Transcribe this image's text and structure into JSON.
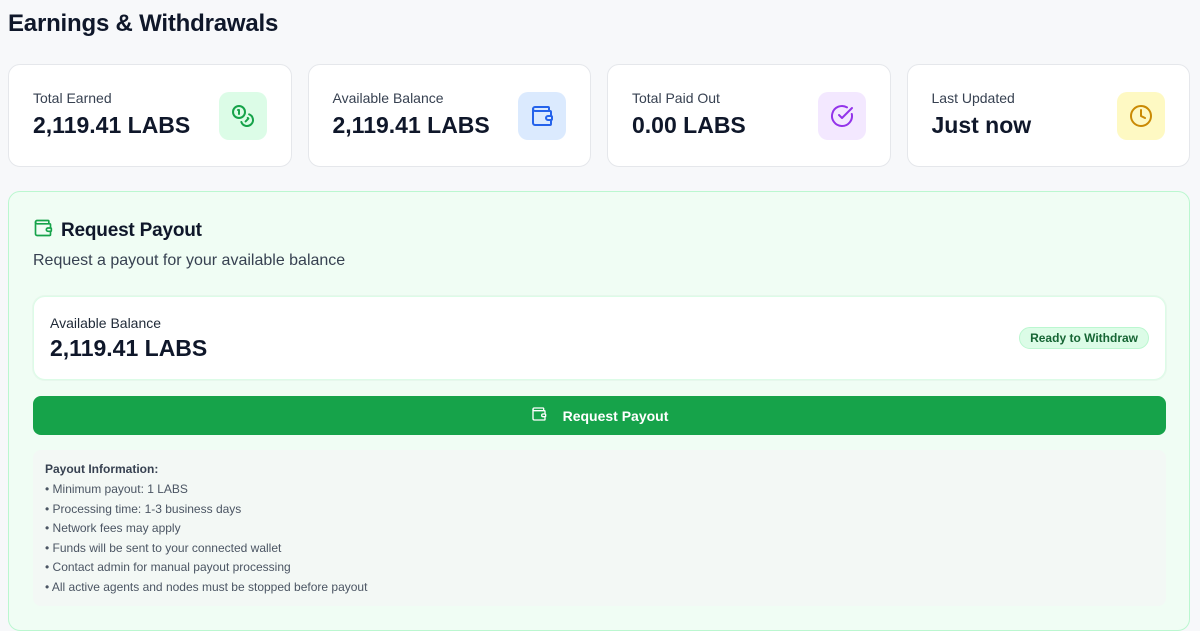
{
  "page": {
    "title": "Earnings & Withdrawals"
  },
  "stats": [
    {
      "label": "Total Earned",
      "value": "2,119.41 LABS",
      "icon": "coins-icon",
      "icon_bg": "#dcfce7",
      "icon_color": "#16a34a"
    },
    {
      "label": "Available Balance",
      "value": "2,119.41 LABS",
      "icon": "wallet-icon",
      "icon_bg": "#dbeafe",
      "icon_color": "#2563eb"
    },
    {
      "label": "Total Paid Out",
      "value": "0.00 LABS",
      "icon": "check-circle-icon",
      "icon_bg": "#f3e8ff",
      "icon_color": "#9333ea"
    },
    {
      "label": "Last Updated",
      "value": "Just now",
      "icon": "clock-icon",
      "icon_bg": "#fef9c3",
      "icon_color": "#ca8a04"
    }
  ],
  "payout": {
    "title": "Request Payout",
    "subtitle": "Request a payout for your available balance",
    "balance_label": "Available Balance",
    "balance_value": "2,119.41 LABS",
    "status_badge": "Ready to Withdraw",
    "button_label": "Request Payout",
    "info_title": "Payout Information:",
    "info_items": [
      "• Minimum payout: 1 LABS",
      "• Processing time: 1-3 business days",
      "• Network fees may apply",
      "• Funds will be sent to your connected wallet",
      "• Contact admin for manual payout processing",
      "• All active agents and nodes must be stopped before payout"
    ]
  },
  "colors": {
    "accent": "#16a34a",
    "panel_bg": "#f0fdf4",
    "panel_border": "#bbf7d0"
  }
}
